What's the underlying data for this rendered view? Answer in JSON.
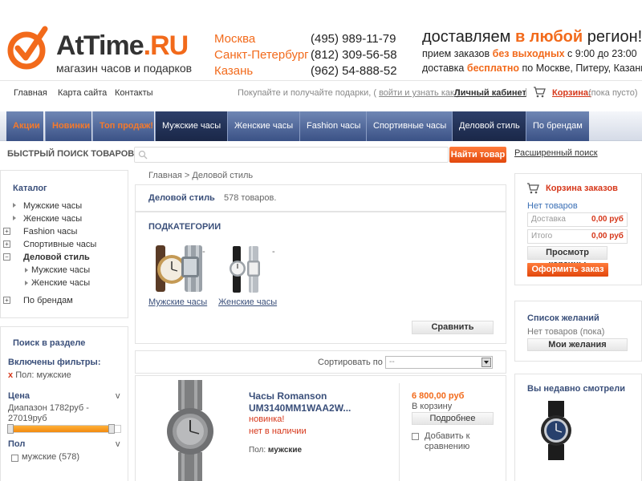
{
  "header": {
    "logo_main": "AtTime",
    "logo_tld": ".RU",
    "logo_sub": "магазин часов и подарков",
    "cities": [
      {
        "city": "Москва",
        "phone": "(495) 989-11-79"
      },
      {
        "city": "Санкт-Петербург",
        "phone": "(812) 309-56-58"
      },
      {
        "city": "Казань",
        "phone": "(962) 54-888-52"
      }
    ],
    "promo_pre": "доставляем ",
    "promo_hl": "в любой",
    "promo_post": " регион!",
    "hours_pre": "прием заказов ",
    "hours_hl": "без выходных",
    "hours_post": " с 9:00 до 23:00",
    "delivery_pre": "доставка ",
    "delivery_hl": "бесплатно",
    "delivery_post": " по Москве, Питеру, Казани"
  },
  "toplinks": {
    "home": "Главная",
    "sitemap": "Карта сайта",
    "contacts": "Контакты",
    "hint_pre": "Покупайте и получайте подарки, ( ",
    "hint_link": "войти и узнать как",
    "hint_post": " )",
    "cabinet": "Личный кабинет",
    "sep": "|",
    "cart": "Корзина:",
    "cart_empty": "(пока пусто)"
  },
  "nav": [
    "Акции",
    "Новинки",
    "Топ продаж!",
    "Мужские часы",
    "Женские часы",
    "Fashion часы",
    "Спортивные часы",
    "Деловой стиль",
    "По брендам"
  ],
  "search": {
    "label": "БЫСТРЫЙ ПОИСК ТОВАРОВ",
    "arrow": ">",
    "button": "Найти товар",
    "advanced": "Расширенный поиск"
  },
  "catalog": {
    "title": "Каталог",
    "items": [
      "Мужские часы",
      "Женские часы",
      "Fashion часы",
      "Спортивные часы",
      "Деловой стиль",
      "Мужские часы",
      "Женские часы",
      "По брендам"
    ],
    "plus": "+",
    "minus": "−"
  },
  "filter": {
    "title": "Поиск в разделе",
    "enabled": "Включены фильтры:",
    "x": "x",
    "applied": "Пол: мужские",
    "price_label": "Цена",
    "toggle": "v",
    "range_line1": "Диапазон 1782руб -",
    "range_line2": "27019руб",
    "price_range_fill": 0.92,
    "gender_label": "Пол",
    "gender_opt": "мужские (578)"
  },
  "main": {
    "breadcrumb": "Главная > Деловой стиль",
    "title": "Деловой стиль",
    "count": "578 товаров.",
    "subcats_title": "ПОДКАТЕГОРИИ",
    "subcats": [
      "Мужские часы",
      "Женские часы"
    ],
    "dash": "-",
    "compare": "Сравнить",
    "sort_label": "Сортировать по",
    "sort_value": "--",
    "product": {
      "title": "Часы Romanson UM3140MM1WAA2W...",
      "new": "новинка!",
      "availability": "нет в наличии",
      "attr_label": "Пол: ",
      "attr_value": "мужские",
      "price": "6 800,00 руб",
      "in_cart": "В корзину",
      "more": "Подробнее",
      "compare": "Добавить к сравнению"
    }
  },
  "right": {
    "cart_title": "Корзина заказов",
    "no_items": "Нет товаров",
    "delivery_label": "Доставка",
    "delivery_value": "0,00 руб",
    "total_label": "Итого",
    "total_value": "0,00 руб",
    "view_cart": "Просмотр корзины",
    "checkout": "Оформить заказ",
    "wish_title": "Список желаний",
    "wish_empty": "Нет товаров (пока)",
    "wish_btn": "Мои желания",
    "seen_title": "Вы недавно смотрели"
  },
  "colors": {
    "accent": "#f26a1b",
    "nav_blue": "#3b5286",
    "link_blue": "#3a4f7a",
    "red": "#d6371a"
  }
}
